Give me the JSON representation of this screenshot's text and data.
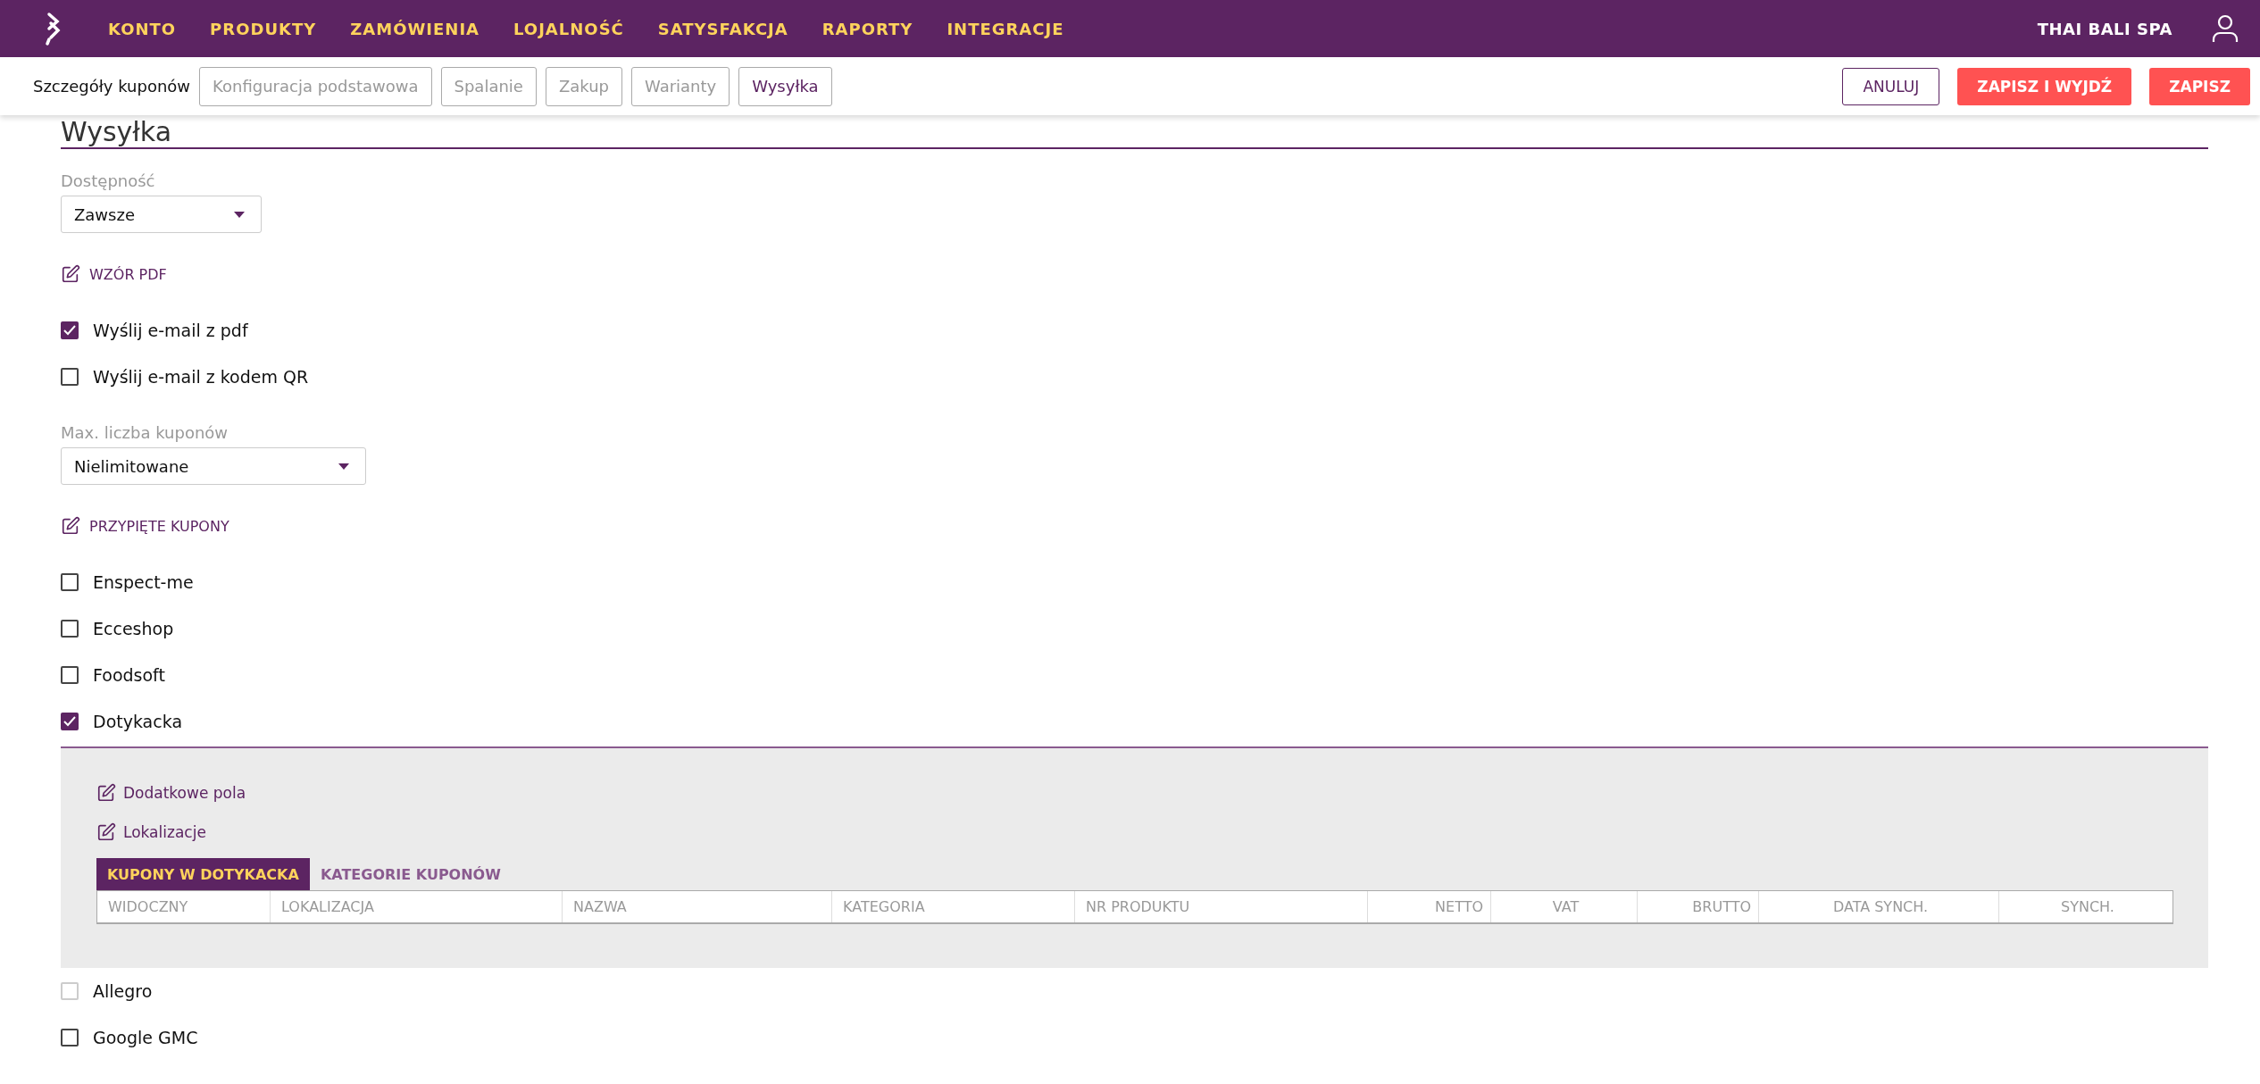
{
  "nav": {
    "items": [
      "KONTO",
      "PRODUKTY",
      "ZAMÓWIENIA",
      "LOJALNOŚĆ",
      "SATYSFAKCJA",
      "RAPORTY",
      "INTEGRACJE"
    ],
    "account": "THAI BALI SPA"
  },
  "subbar": {
    "label": "Szczegóły kuponów",
    "tabs": [
      {
        "label": "Konfiguracja podstawowa",
        "selected": false
      },
      {
        "label": "Spalanie",
        "selected": false
      },
      {
        "label": "Zakup",
        "selected": false
      },
      {
        "label": "Warianty",
        "selected": false
      },
      {
        "label": "Wysyłka",
        "selected": true
      }
    ],
    "buttons": [
      {
        "label": "ANULUJ",
        "kind": "outline"
      },
      {
        "label": "ZAPISZ I WYJDŹ",
        "kind": "primary"
      },
      {
        "label": "ZAPISZ",
        "kind": "primary"
      }
    ]
  },
  "section": {
    "title": "Wysyłka",
    "items": [
      {
        "kind": "select",
        "label": "Dostępność",
        "value": "Zawsze"
      },
      {
        "kind": "link",
        "label": "WZÓR PDF"
      },
      {
        "kind": "checkbox",
        "label": "Wyślij e-mail z pdf",
        "checked": true,
        "disabled": false
      },
      {
        "kind": "checkbox",
        "label": "Wyślij e-mail z kodem QR",
        "checked": false,
        "disabled": false
      },
      {
        "kind": "select",
        "label": "Max. liczba kuponów",
        "value": "Nielimitowane"
      },
      {
        "kind": "link",
        "label": "PRZYPIĘTE KUPONY"
      },
      {
        "kind": "checkbox",
        "label": "Enspect-me",
        "checked": false,
        "disabled": false
      },
      {
        "kind": "checkbox",
        "label": "Ecceshop",
        "checked": false,
        "disabled": false
      },
      {
        "kind": "checkbox",
        "label": "Foodsoft",
        "checked": false,
        "disabled": false
      },
      {
        "kind": "checkbox",
        "label": "Dotykacka",
        "checked": true,
        "disabled": false,
        "expanded": true,
        "panel": {
          "links": [
            "Dodatkowe pola",
            "Lokalizacje"
          ],
          "tabs": [
            {
              "label": "KUPONY W DOTYKACKA",
              "selected": true
            },
            {
              "label": "KATEGORIE KUPONÓW",
              "selected": false
            }
          ],
          "columns": [
            "WIDOCZNY",
            "LOKALIZACJA",
            "NAZWA",
            "KATEGORIA",
            "NR PRODUKTU",
            "NETTO",
            "VAT",
            "BRUTTO",
            "DATA SYNCH.",
            "SYNCH."
          ]
        }
      },
      {
        "kind": "checkbox",
        "label": "Allegro",
        "checked": false,
        "disabled": true
      },
      {
        "kind": "checkbox",
        "label": "Google GMC",
        "checked": false,
        "disabled": false
      }
    ]
  }
}
